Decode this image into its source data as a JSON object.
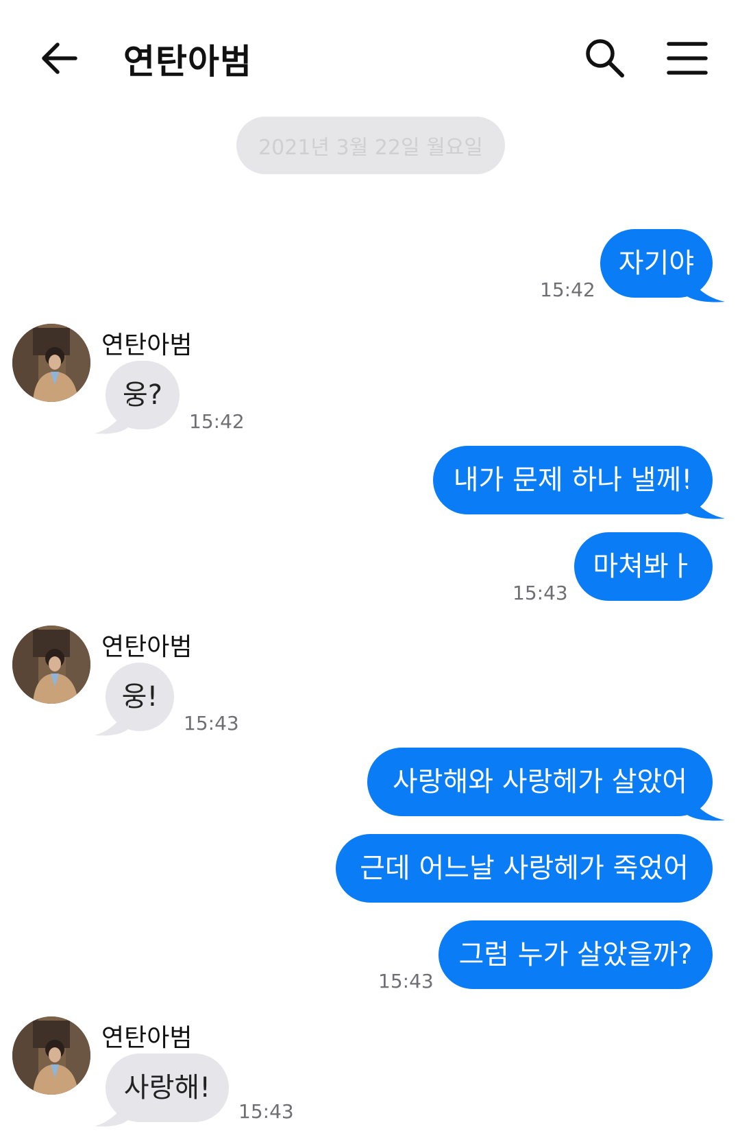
{
  "header": {
    "title": "연탄아범",
    "back_icon": "arrow-left-icon",
    "search_icon": "search-icon",
    "menu_icon": "hamburger-menu-icon"
  },
  "date_separator": "2021년 3월 22일 월요일",
  "colors": {
    "outgoing": "#0a7cf5",
    "incoming": "#e6e6ea",
    "time": "#6f6f73"
  },
  "messages": [
    {
      "from": "me",
      "text": "자기야",
      "time": "15:42"
    },
    {
      "from": "연탄아범",
      "sender": "연탄아범",
      "text": "웅?",
      "time": "15:42"
    },
    {
      "from": "me",
      "text": "내가 문제 하나 낼께!"
    },
    {
      "from": "me",
      "text": "마쳐봐ㅏ",
      "time": "15:43"
    },
    {
      "from": "연탄아범",
      "sender": "연탄아범",
      "text": "웅!",
      "time": "15:43"
    },
    {
      "from": "me",
      "text": "사랑해와 사랑헤가 살았어"
    },
    {
      "from": "me",
      "text": "근데 어느날 사랑헤가 죽었어"
    },
    {
      "from": "me",
      "text": "그럼 누가 살았을까?",
      "time": "15:43"
    },
    {
      "from": "연탄아범",
      "sender": "연탄아범",
      "text": "사랑해!",
      "time": "15:43"
    }
  ]
}
